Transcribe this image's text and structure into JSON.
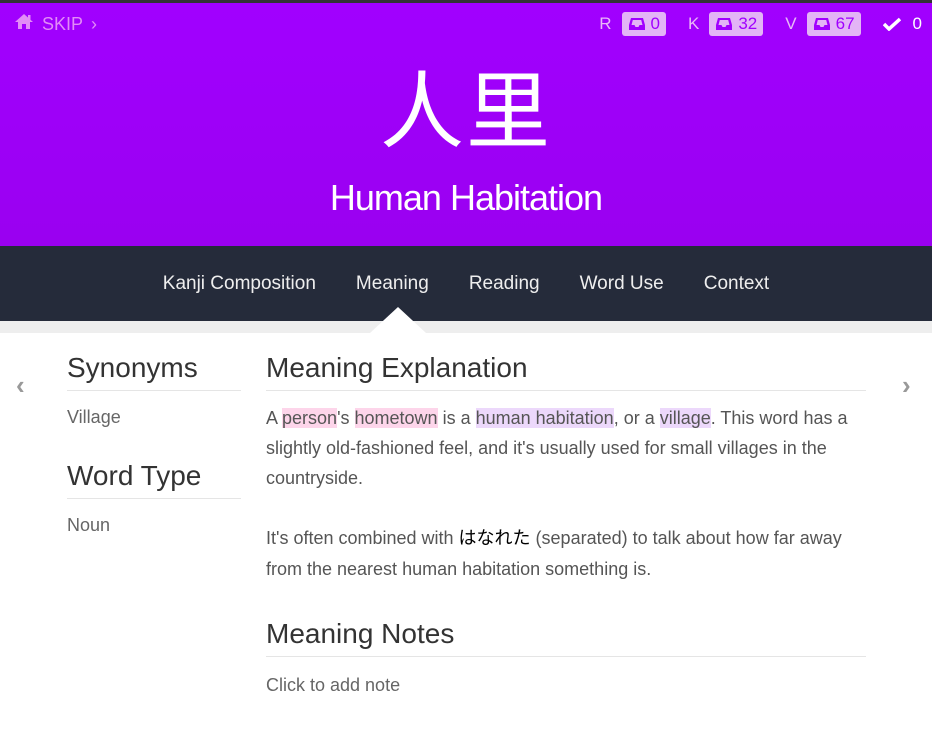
{
  "header": {
    "skip_label": "SKIP",
    "stats": [
      {
        "key": "R",
        "count": "0"
      },
      {
        "key": "K",
        "count": "32"
      },
      {
        "key": "V",
        "count": "67"
      }
    ],
    "completed_count": "0",
    "kanji": "人里",
    "meaning": "Human Habitation",
    "colors": {
      "accent": "#a100ff",
      "nav_bg": "#252b3a"
    }
  },
  "tabs": [
    {
      "label": "Kanji Composition"
    },
    {
      "label": "Meaning",
      "active": true
    },
    {
      "label": "Reading"
    },
    {
      "label": "Word Use"
    },
    {
      "label": "Context"
    }
  ],
  "sidebar": {
    "synonyms_heading": "Synonyms",
    "synonyms_value": "Village",
    "word_type_heading": "Word Type",
    "word_type_value": "Noun"
  },
  "main": {
    "explanation_heading": "Meaning Explanation",
    "p1": {
      "t1": "A ",
      "h1": "person",
      "t2": "'s ",
      "h2": "hometown",
      "t3": " is a ",
      "h3": "human habitation",
      "t4": ", or a ",
      "h4": "village",
      "t5": ". This word has a slightly old-fashioned feel, and it's usually used for small villages in the countryside."
    },
    "p2": {
      "t1": "It's often combined with ",
      "jp": "はなれた",
      "t2": " (separated) to talk about how far away from the nearest human habitation something is."
    },
    "notes_heading": "Meaning Notes",
    "notes_placeholder": "Click to add note"
  }
}
